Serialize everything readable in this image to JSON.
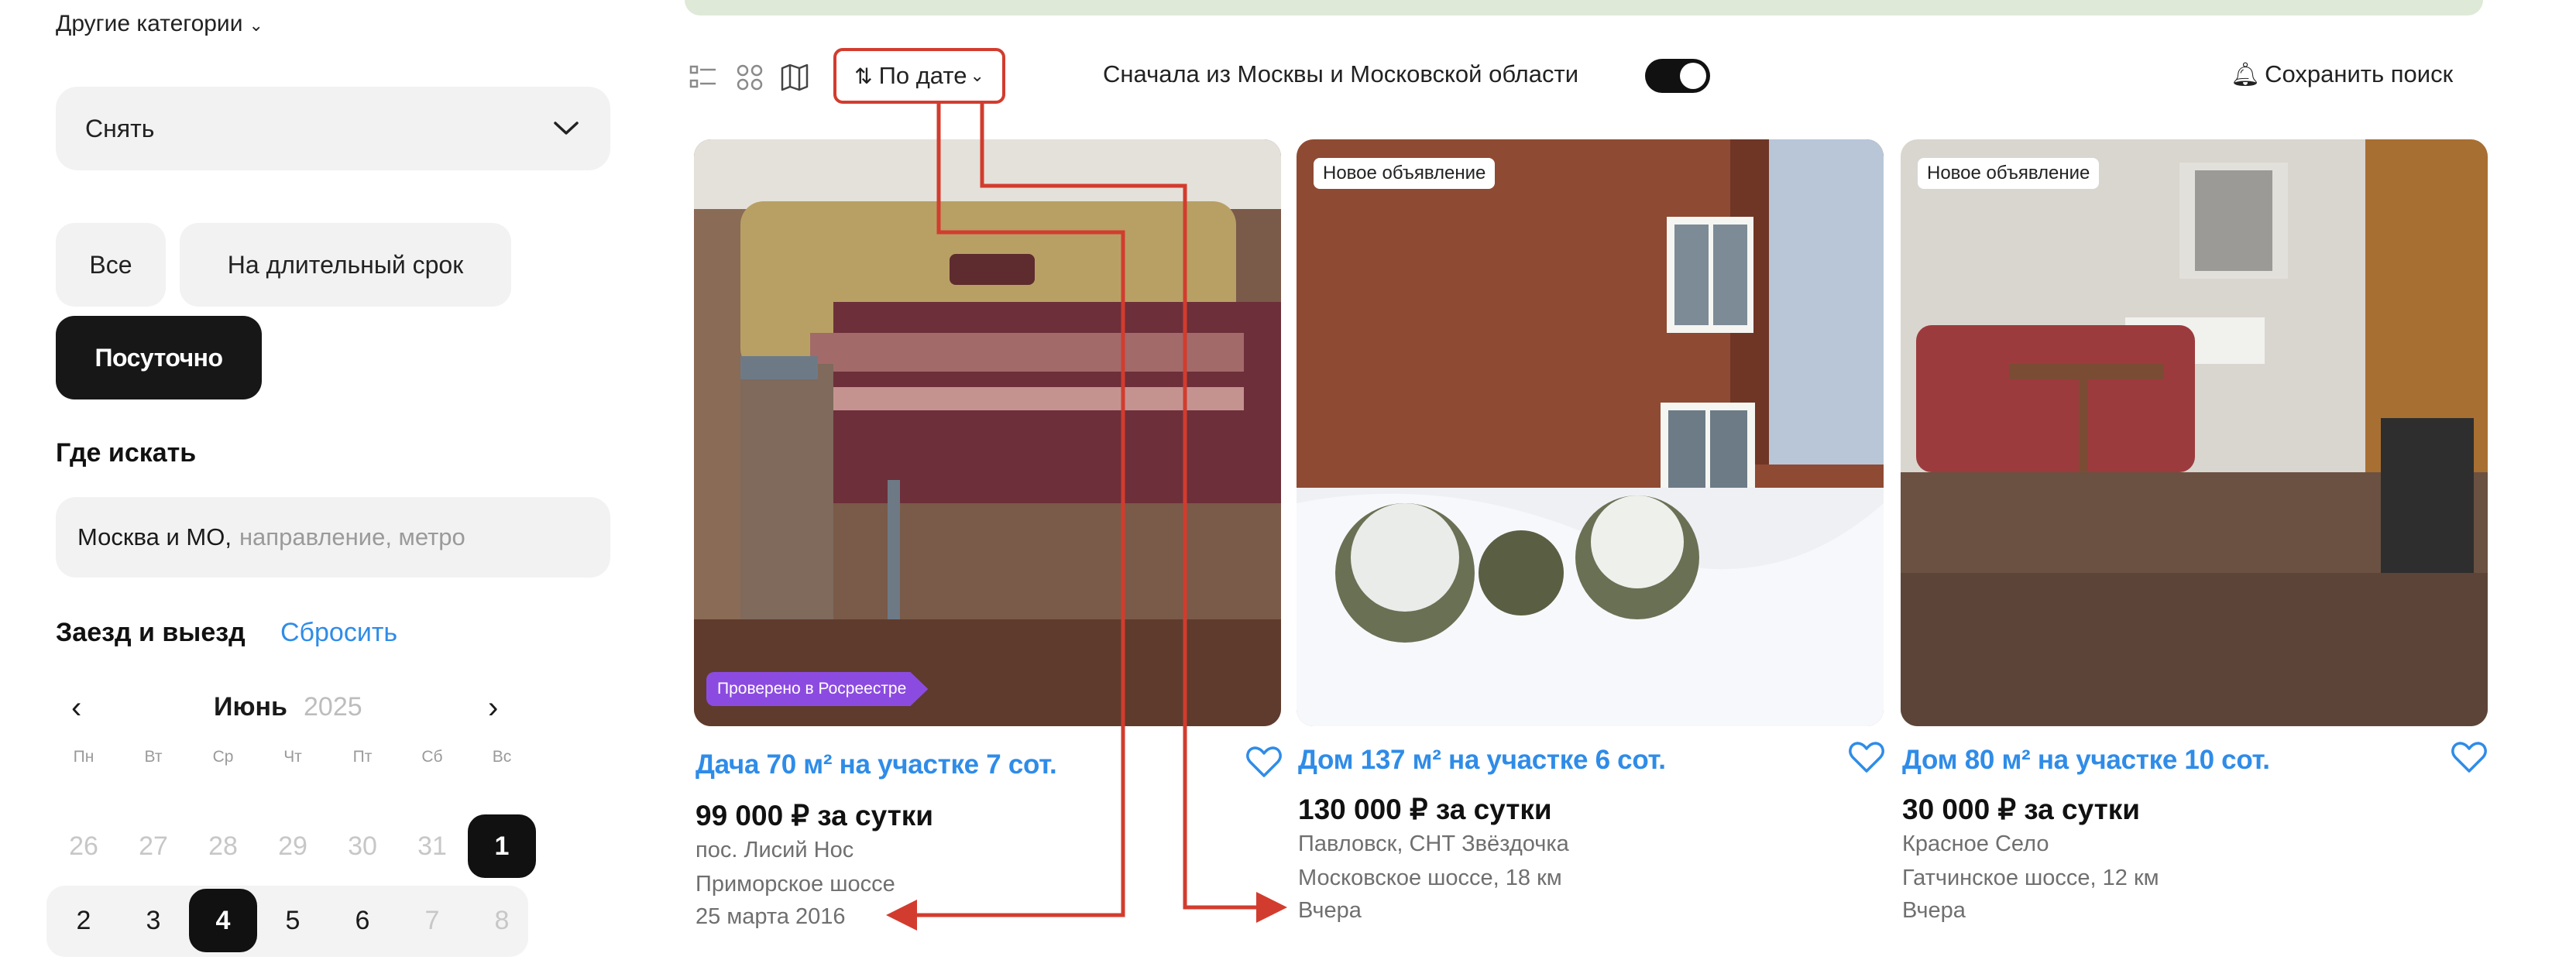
{
  "sidebar": {
    "other_categories": "Другие категории",
    "deal_type": "Снять",
    "rent_chips": [
      "Все",
      "На длительный срок",
      "Посуточно"
    ],
    "where_title": "Где искать",
    "where_value": "Москва и МО,",
    "where_placeholder": "направление, метро",
    "dates_title": "Заезд и выезд",
    "dates_reset": "Сбросить",
    "calendar": {
      "month": "Июнь",
      "year": "2025",
      "prev": "‹",
      "next": "›",
      "weekdays": [
        "Пн",
        "Вт",
        "Ср",
        "Чт",
        "Пт",
        "Сб",
        "Вс"
      ],
      "week1": [
        "26",
        "27",
        "28",
        "29",
        "30",
        "31",
        "1"
      ],
      "week2": [
        "2",
        "3",
        "4",
        "5",
        "6",
        "7",
        "8"
      ]
    }
  },
  "toolbar": {
    "sort_label": "По дате",
    "moscow_first_label": "Сначала из Москвы и Московской области",
    "moscow_first_on": true,
    "save_search": "Сохранить поиск"
  },
  "cards": [
    {
      "badge": "Проверено в Росреестре",
      "title": "Дача 70 м² на участке 7 сот.",
      "price": "99 000 ₽ за сутки",
      "location": "пос. Лисий Нос",
      "address": "Приморское шоссе",
      "date": "25 марта 2016"
    },
    {
      "badge": "Новое объявление",
      "title": "Дом 137 м² на участке 6 сот.",
      "price": "130 000 ₽ за сутки",
      "location": "Павловск, СНТ Звёздочка",
      "address": "Московское шоссе, 18 км",
      "date": "Вчера"
    },
    {
      "badge": "Новое объявление",
      "title": "Дом 80 м² на участке 10 сот.",
      "price": "30 000 ₽ за сутки",
      "location": "Красное Село",
      "address": "Гатчинское шоссе, 12 км",
      "date": "Вчера"
    }
  ],
  "colors": {
    "accent_blue": "#2f8ce8",
    "annotation_red": "#d23c2e",
    "verified_purple": "#8c4be0",
    "selected_dark": "#171717"
  }
}
